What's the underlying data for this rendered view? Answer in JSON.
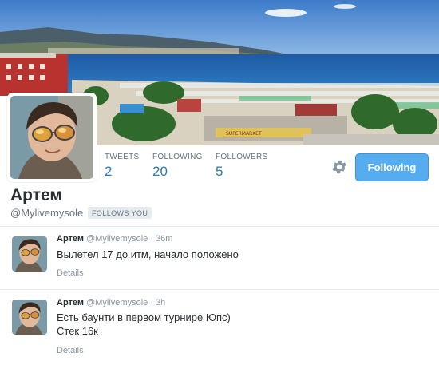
{
  "profile": {
    "name": "Артем",
    "handle": "@Mylivemysole",
    "follows_you": "FOLLOWS YOU"
  },
  "stats": [
    {
      "label": "TWEETS",
      "value": "2"
    },
    {
      "label": "FOLLOWING",
      "value": "20"
    },
    {
      "label": "FOLLOWERS",
      "value": "5"
    }
  ],
  "actions": {
    "follow_label": "Following",
    "settings_icon": "gear-icon"
  },
  "banner": {
    "sign_text": "SUPERMARKET"
  },
  "tweets": [
    {
      "name": "Артем",
      "meta": "@Mylivemysole · 36m",
      "line1": "Вылетел 17 до итм, начало положено",
      "line2": "",
      "details": "Details"
    },
    {
      "name": "Артем",
      "meta": "@Mylivemysole · 3h",
      "line1": "Есть баунти в первом турнире Юпс)",
      "line2": "Стек 16к",
      "details": "Details"
    }
  ],
  "colors": {
    "accent": "#55acee",
    "link": "#2b7bb9",
    "muted": "#66757f"
  }
}
